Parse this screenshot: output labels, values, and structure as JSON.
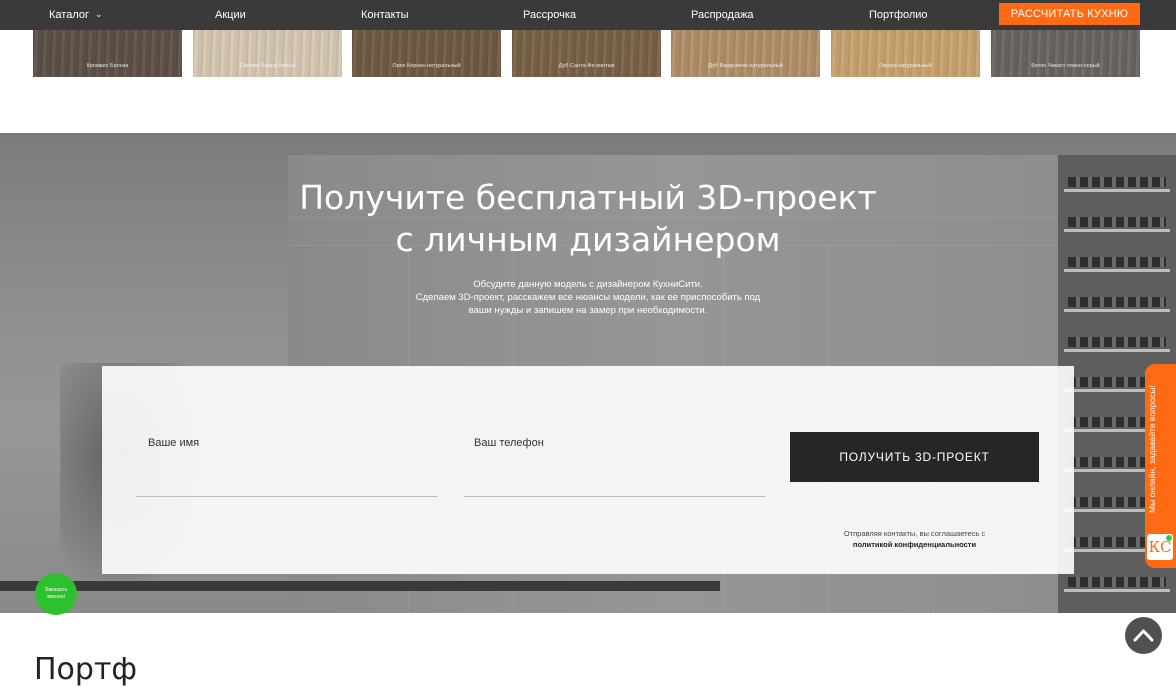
{
  "nav": {
    "items": [
      "Каталог",
      "Акции",
      "Контакты",
      "Рассрочка",
      "Распродажа",
      "Портфолио"
    ],
    "cta": "РАССЧИТАТЬ КУХНЮ"
  },
  "swatches": [
    {
      "label": "Кромвис Бронза",
      "color": "#5d5149"
    },
    {
      "label": "Сонома Блэнд Белый",
      "color": "#d6c8b3"
    },
    {
      "label": "Орех Кернин натуральный",
      "color": "#6f5b44"
    },
    {
      "label": "Дуб Санта-Фе винтаж",
      "color": "#7a6248"
    },
    {
      "label": "Дуб Бардолино натуральный",
      "color": "#b18f6a"
    },
    {
      "label": "Гикори натуральный",
      "color": "#c9a371"
    },
    {
      "label": "Бетон Чикаго темно-серый",
      "color": "#6a6561"
    }
  ],
  "promo": {
    "title_line1": "Получите бесплатный 3D-проект",
    "title_line2": "с личным дизайнером",
    "sub_line1": "Обсудите данную модель с дизайнером КухниСити.",
    "sub_line2": "Сделаем 3D-проект, расскажем все нюансы модели, как ее приспособить под",
    "sub_line3": "ваши нужды и запишем на замер при необходимости."
  },
  "form": {
    "name_label": "Ваше имя",
    "phone_label": "Ваш телефон",
    "submit": "ПОЛУЧИТЬ 3D-ПРОЕКТ",
    "consent_text": "Отправляя контакты, вы соглашаетесь с",
    "consent_link": "политикой конфиденциальности"
  },
  "callback": {
    "line1": "Заказать",
    "line2": "звонок!"
  },
  "chat": {
    "text": "Мы онлайн, задавайте вопросы!",
    "logo": "КС"
  },
  "next_section": {
    "heading": "Портф"
  },
  "colors": {
    "accent": "#ff6a13",
    "nav_bg": "#3a3a3a",
    "button_dark": "#262626",
    "call_green": "#2ec02e"
  }
}
